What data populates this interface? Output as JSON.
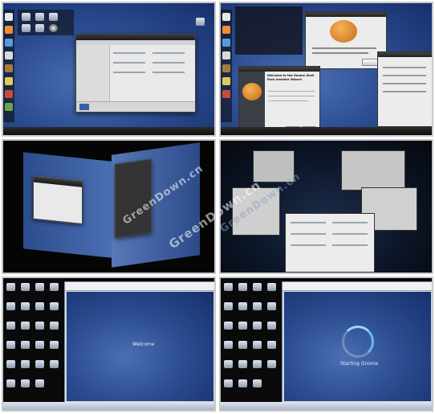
{
  "panels": [
    {
      "id": "gnome-desktop-nautilus"
    },
    {
      "id": "gimp-gnome-splash",
      "splash_title": "Welcome to the Gnome Shell Pack Installer Wizard"
    },
    {
      "id": "compiz-cube"
    },
    {
      "id": "scale-expose"
    },
    {
      "id": "vm-welcome",
      "center_text": "Welcome"
    },
    {
      "id": "vm-starting",
      "center_text": "Starting Gnome"
    }
  ],
  "watermark": {
    "text_1": "GreenDown.cn",
    "text_2": "GreenDown.cn",
    "text_3": "GreenDown.cn"
  },
  "colors": {
    "desktop_blue": "#2d4e93",
    "panel_dark": "#1b1b1b",
    "border": "#c9c9c9",
    "gimp_orange": "#e08a2a"
  },
  "icons": [
    "gimp-icon",
    "folder-icon",
    "computer-icon",
    "spinner-icon"
  ]
}
